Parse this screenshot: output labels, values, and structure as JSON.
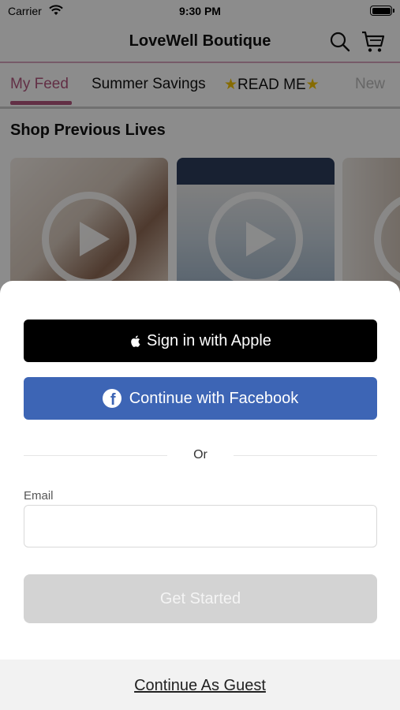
{
  "status_bar": {
    "carrier": "Carrier",
    "time": "9:30 PM",
    "icons": [
      "wifi-icon",
      "battery-icon"
    ]
  },
  "header": {
    "title": "LoveWell Boutique",
    "icons": [
      "search-icon",
      "cart-icon"
    ]
  },
  "tabs": [
    {
      "label": "My Feed",
      "active": true
    },
    {
      "label": "Summer Savings",
      "active": false
    },
    {
      "label": "READ ME",
      "prefix_icon": "star-icon",
      "suffix_icon": "star-icon",
      "active": false
    },
    {
      "label": "New",
      "active": false
    }
  ],
  "main": {
    "section_title": "Shop Previous Lives",
    "cards": [
      {
        "icon": "play-icon"
      },
      {
        "icon": "play-icon"
      },
      {
        "icon": "play-icon"
      }
    ]
  },
  "sheet": {
    "apple_label": "Sign in with Apple",
    "facebook_label": "Continue with Facebook",
    "or_text": "Or",
    "email_label": "Email",
    "email_value": "",
    "get_started_label": "Get Started",
    "guest_label": "Continue As Guest"
  },
  "colors": {
    "accent": "#b3567f",
    "facebook": "#3d65b5",
    "apple": "#000000",
    "disabled_button": "#d3d3d3"
  }
}
